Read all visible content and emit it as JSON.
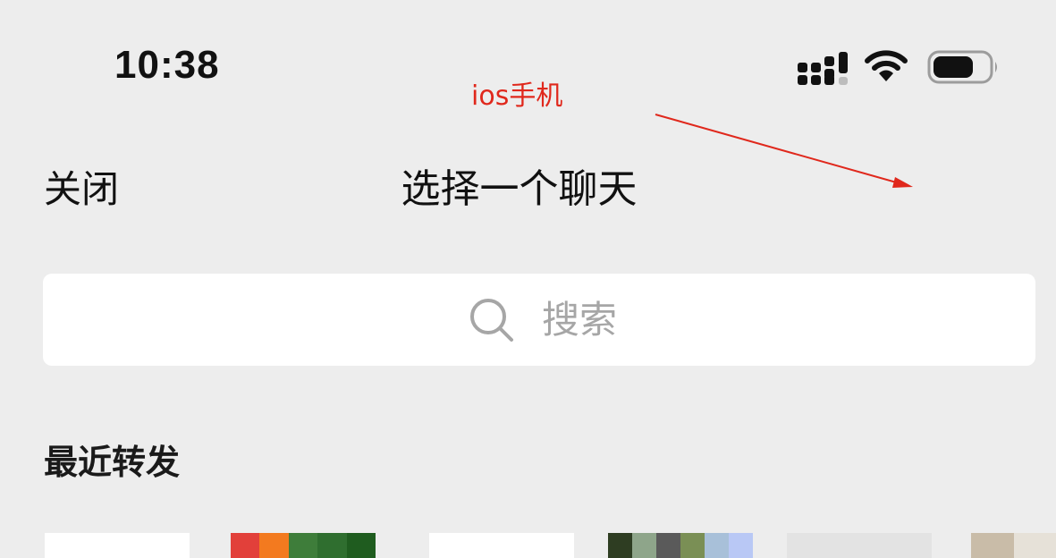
{
  "status_bar": {
    "time": "10:38",
    "icons": [
      "signal-icon",
      "wifi-icon",
      "battery-icon"
    ]
  },
  "annotation": {
    "text": "ios手机",
    "color": "#e0281c"
  },
  "nav": {
    "close_label": "关闭",
    "title": "选择一个聊天"
  },
  "search": {
    "placeholder": "搜索",
    "icon": "search-icon"
  },
  "recent": {
    "title": "最近转发",
    "avatars": [
      {
        "colors": [
          "#ffffff"
        ]
      },
      {
        "colors": [
          "#e2403a",
          "#f37a1f",
          "#3e7d3a",
          "#2f6e2f",
          "#1f5c1f"
        ]
      },
      {
        "colors": [
          "#ffffff"
        ]
      },
      {
        "colors": [
          "#2e3d22",
          "#8ea58a",
          "#5a5a5a",
          "#7a8f55",
          "#a8c0d9",
          "#b9c8f5"
        ]
      },
      {
        "colors": [
          "#e3e3e3"
        ]
      },
      {
        "colors": [
          "#c9bca8",
          "#e6e1d8"
        ]
      }
    ]
  },
  "colors": {
    "background": "#ededed",
    "search_background": "#ffffff",
    "placeholder": "#a6a6a6"
  }
}
